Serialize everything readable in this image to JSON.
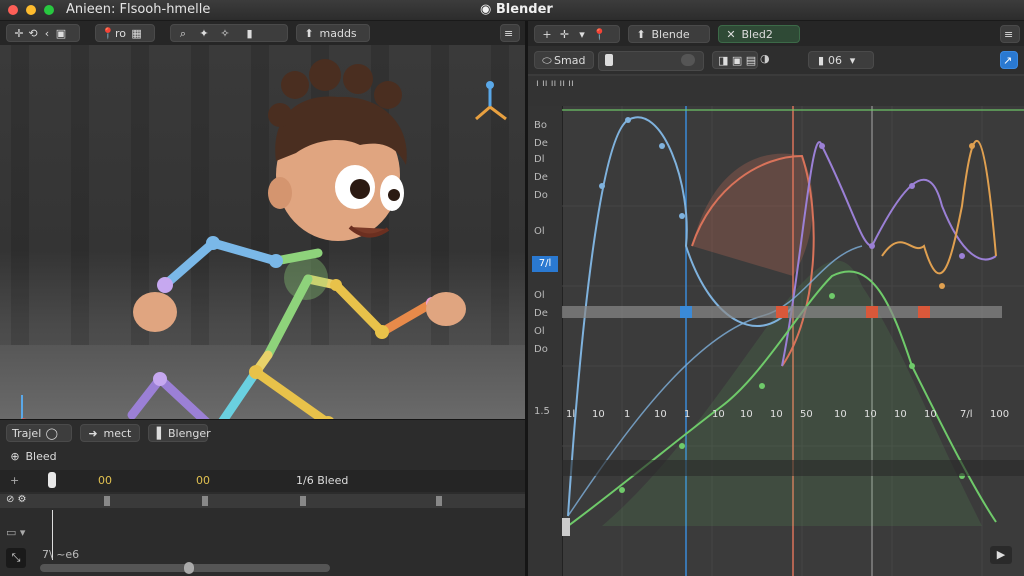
{
  "title_bar": {
    "left_title": "Anieen: Flsooh-hmelle",
    "app_title": "Blender"
  },
  "viewport": {
    "header_tool_label": "ro",
    "header_mode_label": "madds"
  },
  "timeline": {
    "tabs": [
      {
        "label": "Trajel"
      },
      {
        "label": "mect"
      },
      {
        "label": "Blenger"
      }
    ],
    "track_label": "Bleed",
    "frame_markers": [
      "00",
      "00",
      "1/6 Bleed"
    ],
    "footer_label": "7\\ ~e6"
  },
  "graph_editor": {
    "tabs": [
      {
        "label": "Blende"
      },
      {
        "label": "Bled2"
      }
    ],
    "snap_label": "Smad",
    "frame_field": "06",
    "channels": [
      "Bo",
      "De",
      "Dl",
      "De",
      "Do",
      "Ol",
      "Ol",
      "De",
      "Ol",
      "Do"
    ],
    "highlight_channel": "7/l",
    "x_ticks": [
      "1l",
      "10",
      "1",
      "10",
      "1",
      "10",
      "10",
      "10",
      "50",
      "10",
      "10",
      "10",
      "10",
      "7/l",
      "100"
    ],
    "axis_corner": "1.5"
  },
  "colors": {
    "accent": "#2a79d1",
    "series_blue": "#7fb2dd",
    "series_red": "#d9735a",
    "series_purple": "#9b80d6",
    "series_orange": "#e0a050",
    "series_green": "#6fca6a"
  }
}
